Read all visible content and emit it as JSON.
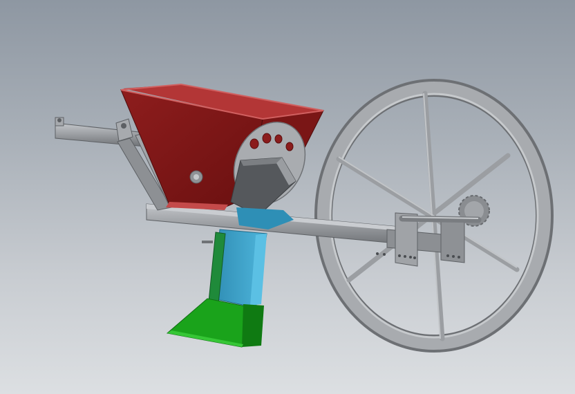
{
  "scene": {
    "subject": "seed-planter-cad-model",
    "colors": {
      "background_top": "#8e97a2",
      "background_bottom": "#dcdfe2",
      "hopper": "#8b1c1c",
      "hopper_dark": "#6e1212",
      "hopper_light": "#b23a3a",
      "frame_metal": "#8f9296",
      "frame_metal_light": "#b9bcc0",
      "frame_metal_dark": "#5d6064",
      "furrow_opener": "#3a9ec4",
      "opener_mount": "#1f8a3a",
      "shoe": "#19a31a",
      "shoe_dark": "#0f7a12"
    }
  }
}
